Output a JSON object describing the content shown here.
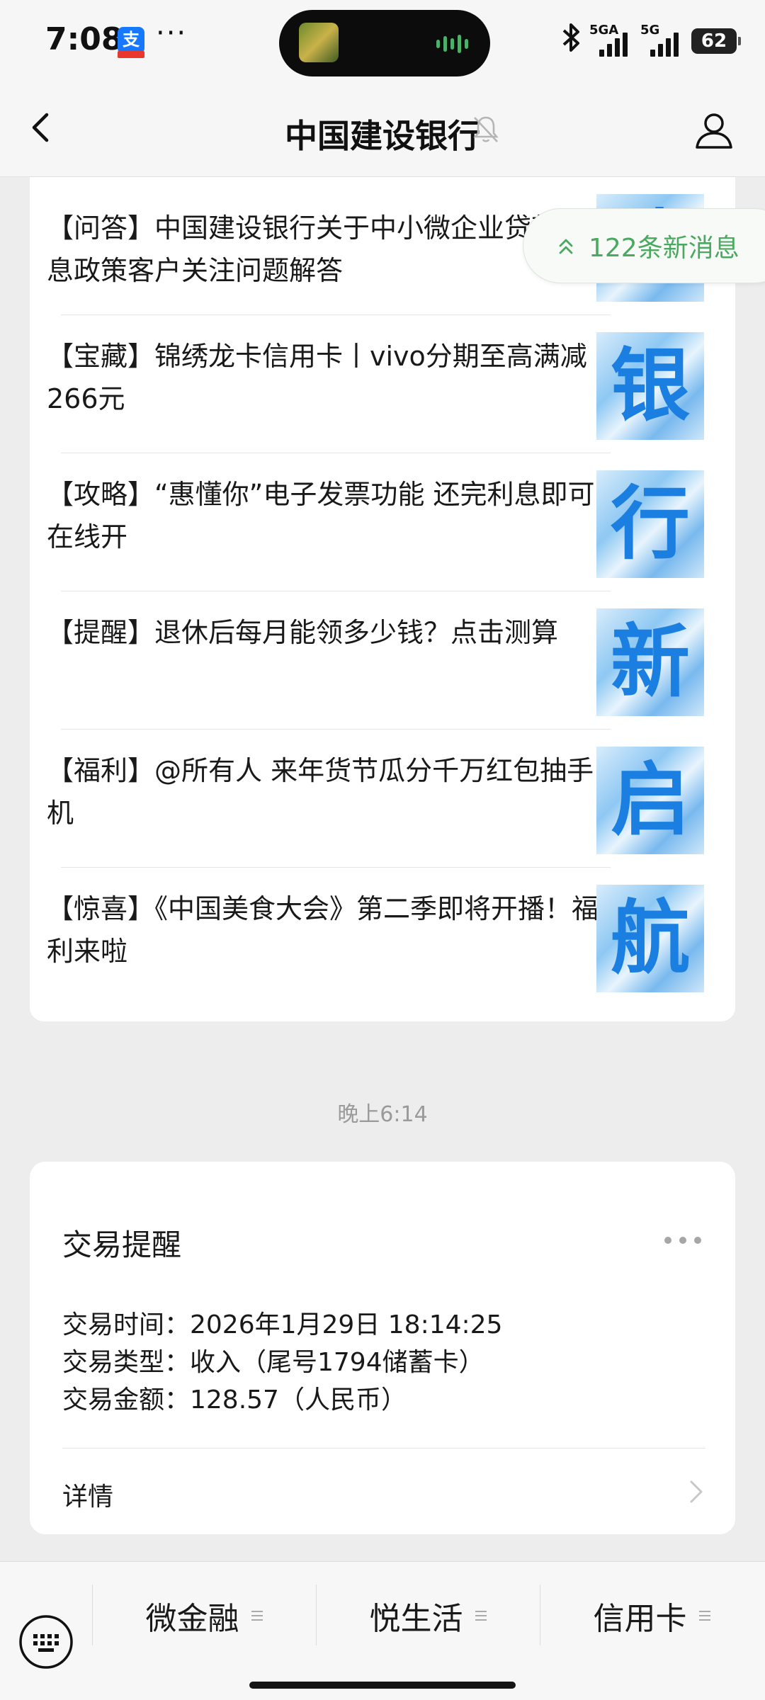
{
  "status_bar": {
    "time": "7:08",
    "notification_app_badge": "支",
    "more_indicator": "···",
    "network_1": "5GA",
    "network_2": "5G",
    "battery": "62"
  },
  "nav": {
    "title": "中国建设银行"
  },
  "new_messages": {
    "label": "122条新消息"
  },
  "articles": [
    {
      "title": "【问答】中国建设银行关于中小微企业贷款贴息政策客户关注问题解答",
      "thumb_char": "建"
    },
    {
      "title": "【宝藏】锦绣龙卡信用卡丨vivo分期至高满减266元",
      "thumb_char": "银"
    },
    {
      "title": "【攻略】“惠懂你”电子发票功能 还完利息即可在线开",
      "thumb_char": "行"
    },
    {
      "title": "【提醒】退休后每月能领多少钱？点击测算",
      "thumb_char": "新"
    },
    {
      "title": "【福利】@所有人 来年货节瓜分千万红包抽手机",
      "thumb_char": "启"
    },
    {
      "title": "【惊喜】《中国美食大会》第二季即将开播！福利来啦",
      "thumb_char": "航"
    }
  ],
  "timestamp": "晚上6:14",
  "transaction": {
    "title": "交易提醒",
    "time_line": "交易时间：2026年1月29日 18:14:25",
    "type_line": "交易类型：收入（尾号1794储蓄卡）",
    "amount_line": "交易金额：128.57（人民币）",
    "details_label": "详情"
  },
  "menu": {
    "tabs": [
      {
        "label": "微金融"
      },
      {
        "label": "悦生活"
      },
      {
        "label": "信用卡"
      }
    ]
  },
  "colors": {
    "accent_green": "#4aa860",
    "thumb_blue": "#1a7fe0",
    "background": "#ededed"
  }
}
